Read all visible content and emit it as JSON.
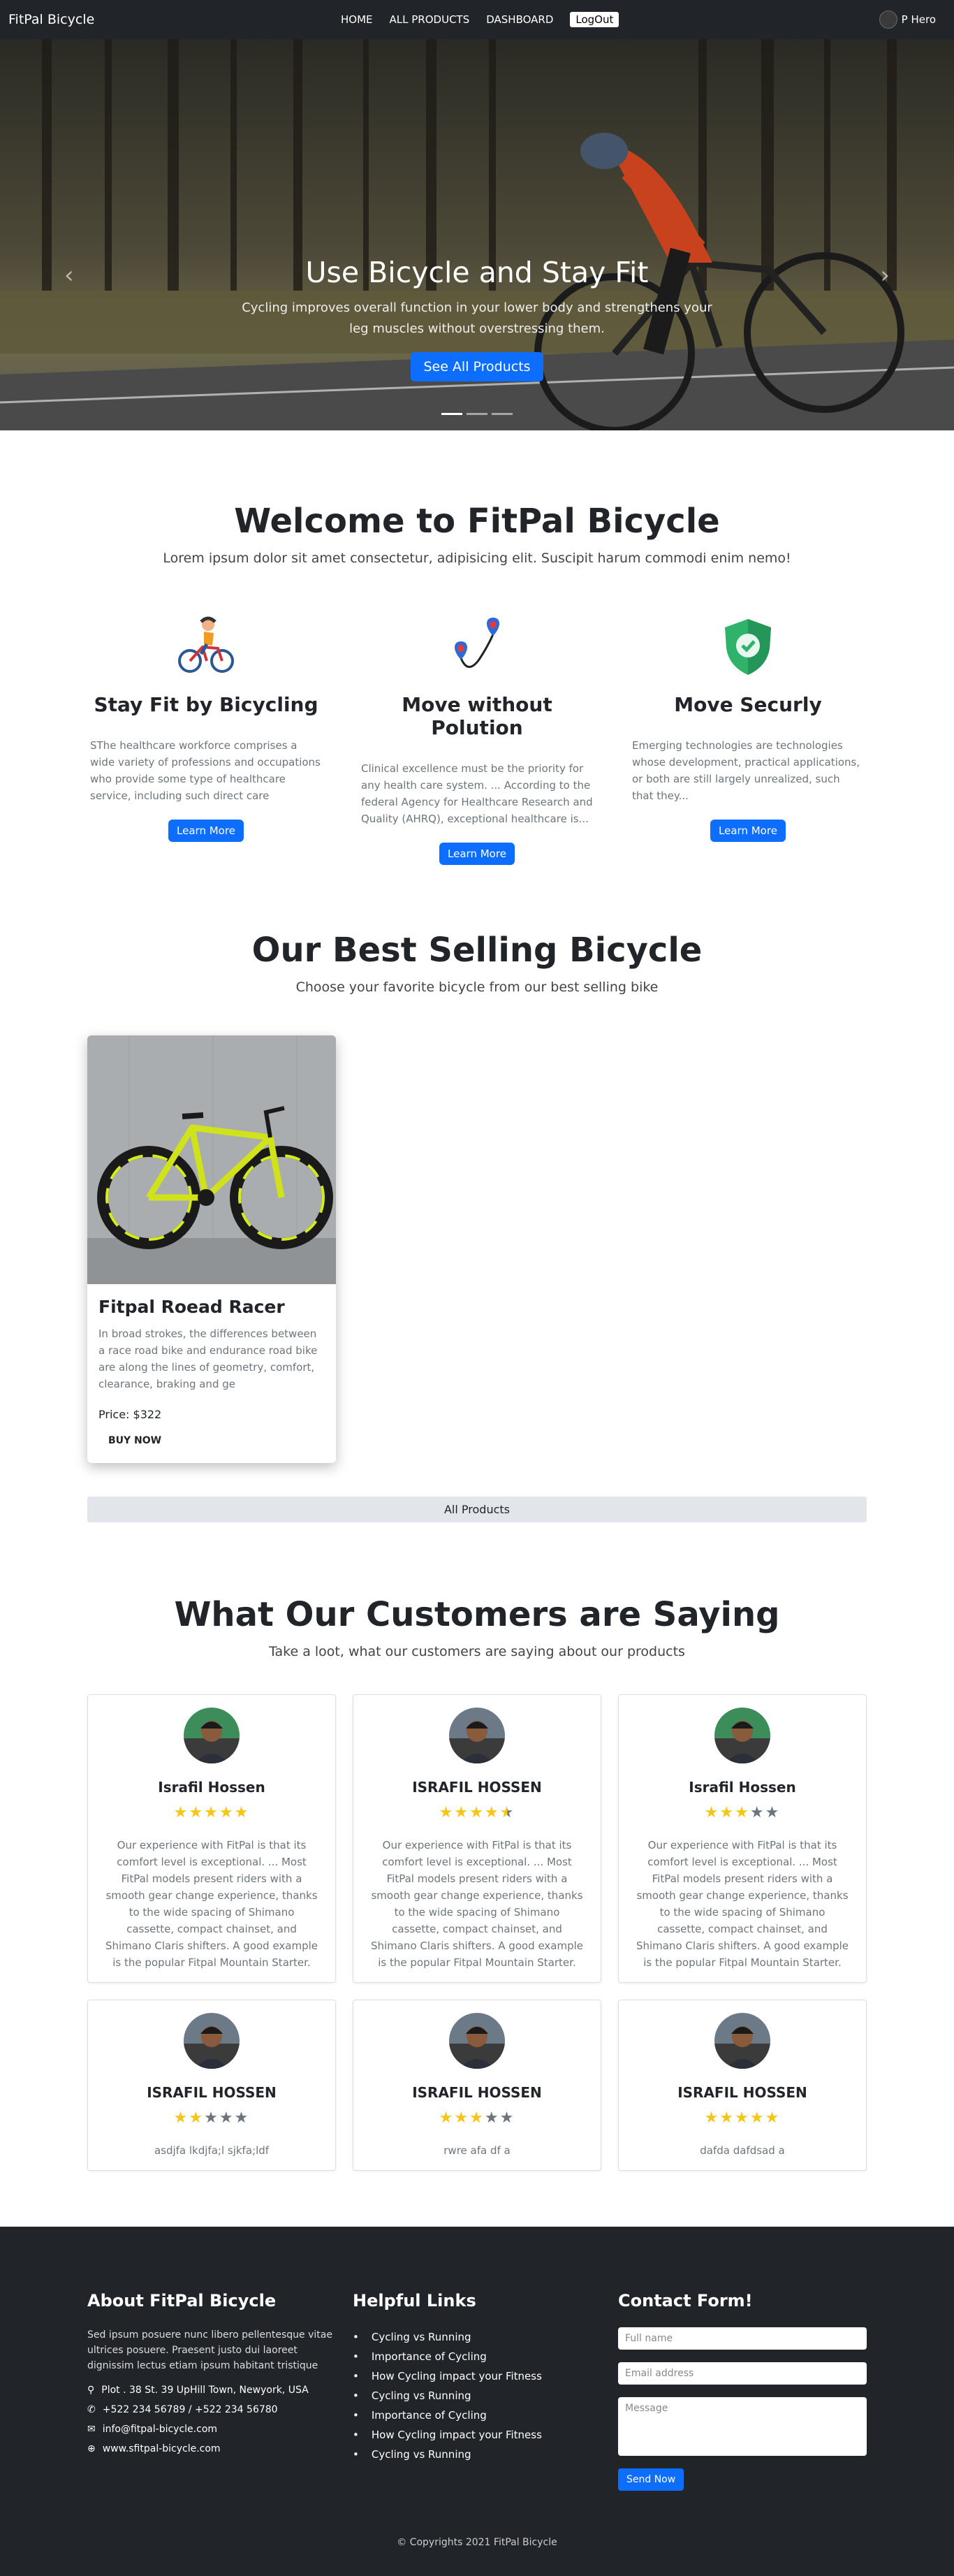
{
  "nav": {
    "brand": "FitPal Bicycle",
    "links": [
      "HOME",
      "ALL PRODUCTS",
      "DASHBOARD"
    ],
    "logout": "LogOut",
    "user": "P Hero"
  },
  "hero": {
    "title": "Use Bicycle and Stay Fit",
    "text": "Cycling improves overall function in your lower body and strengthens your leg muscles without overstressing them.",
    "button": "See All Products",
    "prev": "‹",
    "next": "›",
    "active_slide": 1,
    "slide_count": 3
  },
  "welcome": {
    "title": "Welcome to FitPal Bicycle",
    "subtitle": "Lorem ipsum dolor sit amet consectetur, adipisicing elit. Suscipit harum commodi enim nemo!",
    "features": [
      {
        "icon": "cyclist-icon",
        "title": "Stay Fit by Bicycling",
        "text": "SThe healthcare workforce comprises a wide variety of professions and occupations who provide some type of healthcare service, including such direct care practitioners as...",
        "button": "Learn More"
      },
      {
        "icon": "route-pins-icon",
        "title": "Move without Polution",
        "text": "Clinical excellence must be the priority for any health care system. ... According to the federal Agency for Healthcare Research and Quality (AHRQ), exceptional healthcare is...",
        "button": "Learn More"
      },
      {
        "icon": "shield-check-icon",
        "title": "Move Securly",
        "text": "Emerging technologies are technologies whose development, practical applications, or both are still largely unrealized, such that they...",
        "button": "Learn More"
      }
    ]
  },
  "best": {
    "title": "Our Best Selling Bicycle",
    "subtitle": "Choose your favorite bicycle from our best selling bike",
    "products": [
      {
        "name": "Fitpal Roead Racer",
        "description": "In broad strokes, the differences between a race road bike and endurance road bike are along the lines of geometry, comfort, clearance, braking and ge",
        "price": "Price: $322",
        "button": "BUY NOW"
      }
    ],
    "all_button": "All Products"
  },
  "reviews": {
    "title": "What Our Customers are Saying",
    "subtitle": "Take a loot, what our customers are saying about our products",
    "items": [
      {
        "name": "Israfil Hossen",
        "rating": 5,
        "text": "Our experience with FitPal is that its comfort level is exceptional. ... Most FitPal models present riders with a smooth gear change experience, thanks to the wide spacing of Shimano cassette, compact chainset, and Shimano Claris shifters. A good example is the popular Fitpal Mountain Starter."
      },
      {
        "name": "ISRAFIL HOSSEN",
        "rating": 4.5,
        "text": "Our experience with FitPal is that its comfort level is exceptional. ... Most FitPal models present riders with a smooth gear change experience, thanks to the wide spacing of Shimano cassette, compact chainset, and Shimano Claris shifters. A good example is the popular Fitpal Mountain Starter."
      },
      {
        "name": "Israfil Hossen",
        "rating": 3,
        "text": "Our experience with FitPal is that its comfort level is exceptional. ... Most FitPal models present riders with a smooth gear change experience, thanks to the wide spacing of Shimano cassette, compact chainset, and Shimano Claris shifters. A good example is the popular Fitpal Mountain Starter."
      },
      {
        "name": "ISRAFIL HOSSEN",
        "rating": 2,
        "text": "asdjfa lkdjfa;l sjkfa;ldf"
      },
      {
        "name": "ISRAFIL HOSSEN",
        "rating": 3,
        "text": "rwre afa df a"
      },
      {
        "name": "ISRAFIL HOSSEN",
        "rating": 5,
        "text": "dafda dafdsad a"
      }
    ]
  },
  "footer": {
    "about_title": "About FitPal Bicycle",
    "about_text": "Sed ipsum posuere nunc libero pellentesque vitae ultrices posuere. Praesent justo dui laoreet dignissim lectus etiam ipsum habitant tristique",
    "address": "Plot . 38 St. 39 UpHill Town, Newyork, USA",
    "phone": "+522 234 56789 / +522 234 56780",
    "email": "info@fitpal-bicycle.com",
    "website": "www.sfitpal-bicycle.com",
    "links_title": "Helpful Links",
    "links": [
      "Cycling vs Running",
      "Importance of Cycling",
      "How Cycling impact your Fitness",
      "Cycling vs Running",
      "Importance of Cycling",
      "How Cycling impact your Fitness",
      "Cycling vs Running"
    ],
    "contact_title": "Contact Form!",
    "name_placeholder": "Full name",
    "email_placeholder": "Email address",
    "message_placeholder": "Message",
    "send": "Send Now",
    "copyright": "© Copyrights 2021 FitPal Bicycle"
  }
}
